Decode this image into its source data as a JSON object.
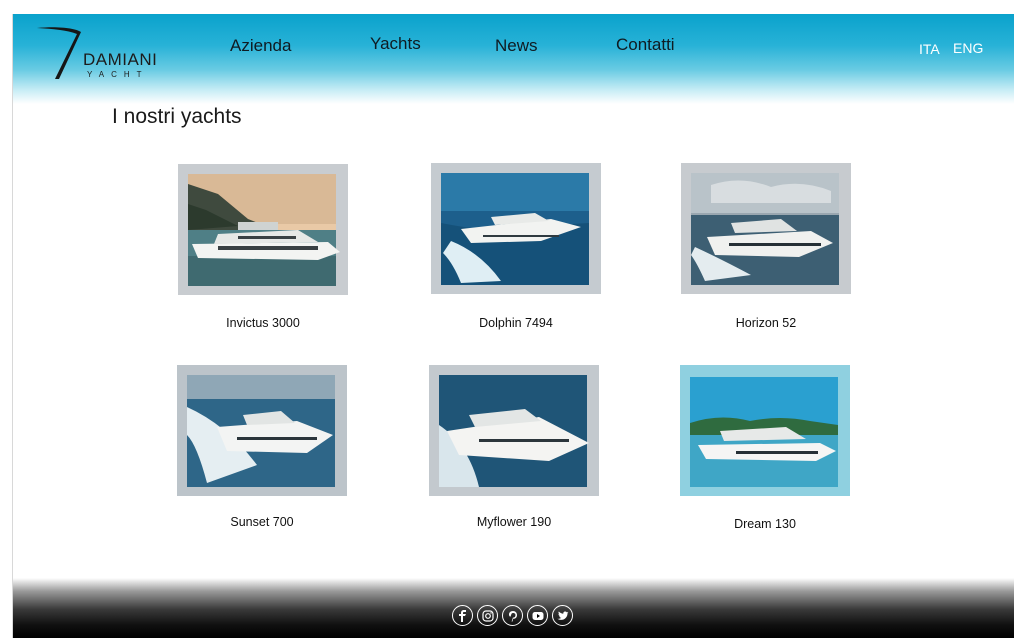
{
  "brand": {
    "name": "DAMIANI",
    "sub": "YACHT"
  },
  "nav": {
    "items": [
      {
        "label": "Azienda"
      },
      {
        "label": "Yachts"
      },
      {
        "label": "News"
      },
      {
        "label": "Contatti"
      }
    ]
  },
  "lang": {
    "ita": "ITA",
    "eng": "ENG"
  },
  "page": {
    "title": "I nostri yachts"
  },
  "yachts": [
    {
      "name": "Invictus 3000"
    },
    {
      "name": "Dolphin 7494"
    },
    {
      "name": "Horizon 52"
    },
    {
      "name": "Sunset 700"
    },
    {
      "name": "Myflower 190"
    },
    {
      "name": "Dream 130"
    }
  ],
  "footer": {
    "social": [
      "facebook-icon",
      "instagram-icon",
      "pinterest-icon",
      "youtube-icon",
      "twitter-icon"
    ]
  }
}
